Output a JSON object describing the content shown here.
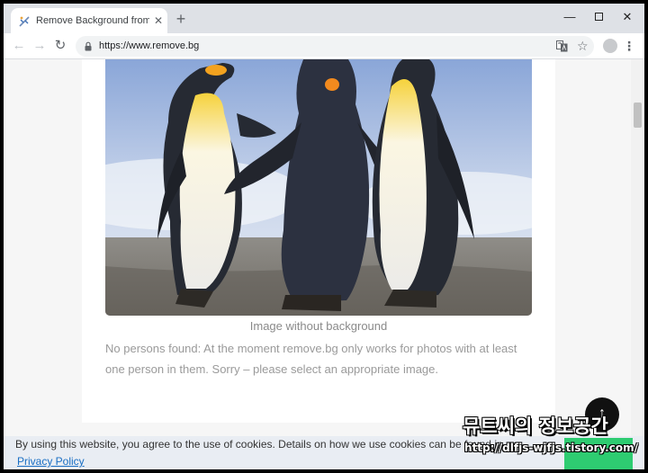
{
  "tab": {
    "title": "Remove Background from Image",
    "favicon_icon": "remove-bg-favicon-icon",
    "close_glyph": "✕",
    "new_tab_glyph": "+"
  },
  "window_controls": {
    "minimize": "—",
    "close": "✕"
  },
  "toolbar": {
    "back_glyph": "←",
    "forward_glyph": "→",
    "reload_glyph": "↻",
    "url": "https://www.remove.bg",
    "star_glyph": "☆",
    "menu_glyph": "⋮"
  },
  "content": {
    "caption": "Image without background",
    "message": "No persons found: At the moment remove.bg only works for photos with at least one person in them. Sorry – please select an appropriate image."
  },
  "back_to_top_glyph": "↑",
  "cookie_banner": {
    "text": "By using this website, you agree to the use of cookies. Details on how we use cookies can be found in our",
    "privacy_link": "Privacy Policy"
  },
  "watermark": {
    "title": "뮤트씨의 정보공간",
    "url": "http://dlfjs-wjfjs.tistory.com/"
  },
  "colors": {
    "accept_button": "#2ecc71",
    "link": "#1a6fc4",
    "tabstrip": "#dee1e6"
  }
}
